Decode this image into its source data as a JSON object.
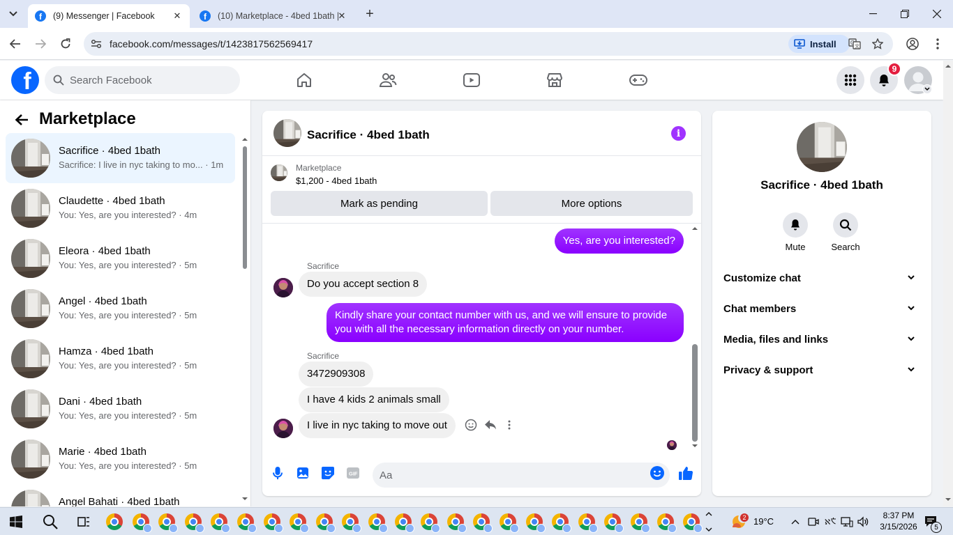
{
  "browser": {
    "tabs": [
      {
        "title": "(9) Messenger | Facebook",
        "active": true
      },
      {
        "title": "(10) Marketplace - 4bed 1bath |",
        "active": false
      }
    ],
    "url": "facebook.com/messages/t/1423817562569417",
    "install_label": "Install"
  },
  "fb": {
    "search_placeholder": "Search Facebook",
    "notification_count": "9"
  },
  "sidebar": {
    "title": "Marketplace",
    "conversations": [
      {
        "name": "Sacrifice · 4bed 1bath",
        "snippet": "Sacrifice: I live in nyc taking to mo... · 1m",
        "selected": true
      },
      {
        "name": "Claudette · 4bed 1bath",
        "snippet": "You: Yes, are you interested? · 4m"
      },
      {
        "name": "Eleora · 4bed 1bath",
        "snippet": "You: Yes, are you interested? · 5m"
      },
      {
        "name": "Angel · 4bed 1bath",
        "snippet": "You: Yes, are you interested? · 5m"
      },
      {
        "name": "Hamza · 4bed 1bath",
        "snippet": "You: Yes, are you interested? · 5m"
      },
      {
        "name": "Dani · 4bed 1bath",
        "snippet": "You: Yes, are you interested? · 5m"
      },
      {
        "name": "Marie · 4bed 1bath",
        "snippet": "You: Yes, are you interested? · 5m"
      },
      {
        "name": "Angel Bahati · 4bed 1bath",
        "snippet": ""
      }
    ]
  },
  "chat": {
    "title": "Sacrifice · 4bed 1bath",
    "listing": {
      "source": "Marketplace",
      "price_title": "$1,200 - 4bed 1bath",
      "pending_label": "Mark as pending",
      "more_label": "More options"
    },
    "messages": {
      "out1": "Yes, are you interested?",
      "sender1": "Sacrifice",
      "in1": "Do you accept section 8",
      "out2": "Kindly share your contact number with us, and we will ensure to provide you with all the necessary information directly on your number.",
      "sender2": "Sacrifice",
      "in2": "3472909308",
      "in3": "I have 4 kids 2 animals small",
      "in4": "I live in nyc taking to move out"
    },
    "input_placeholder": "Aa"
  },
  "info": {
    "name": "Sacrifice · 4bed 1bath",
    "actions": [
      {
        "label": "Mute",
        "icon": "bell-icon"
      },
      {
        "label": "Search",
        "icon": "search-icon"
      }
    ],
    "sections": [
      "Customize chat",
      "Chat members",
      "Media, files and links",
      "Privacy & support"
    ]
  },
  "taskbar": {
    "weather_temp": "19°C",
    "weather_badge": "2",
    "time": "8:37 PM",
    "date": "3/15/2026",
    "notif_count": "5"
  },
  "colors": {
    "accent": "#a033ff",
    "facebook_blue": "#0866ff"
  }
}
